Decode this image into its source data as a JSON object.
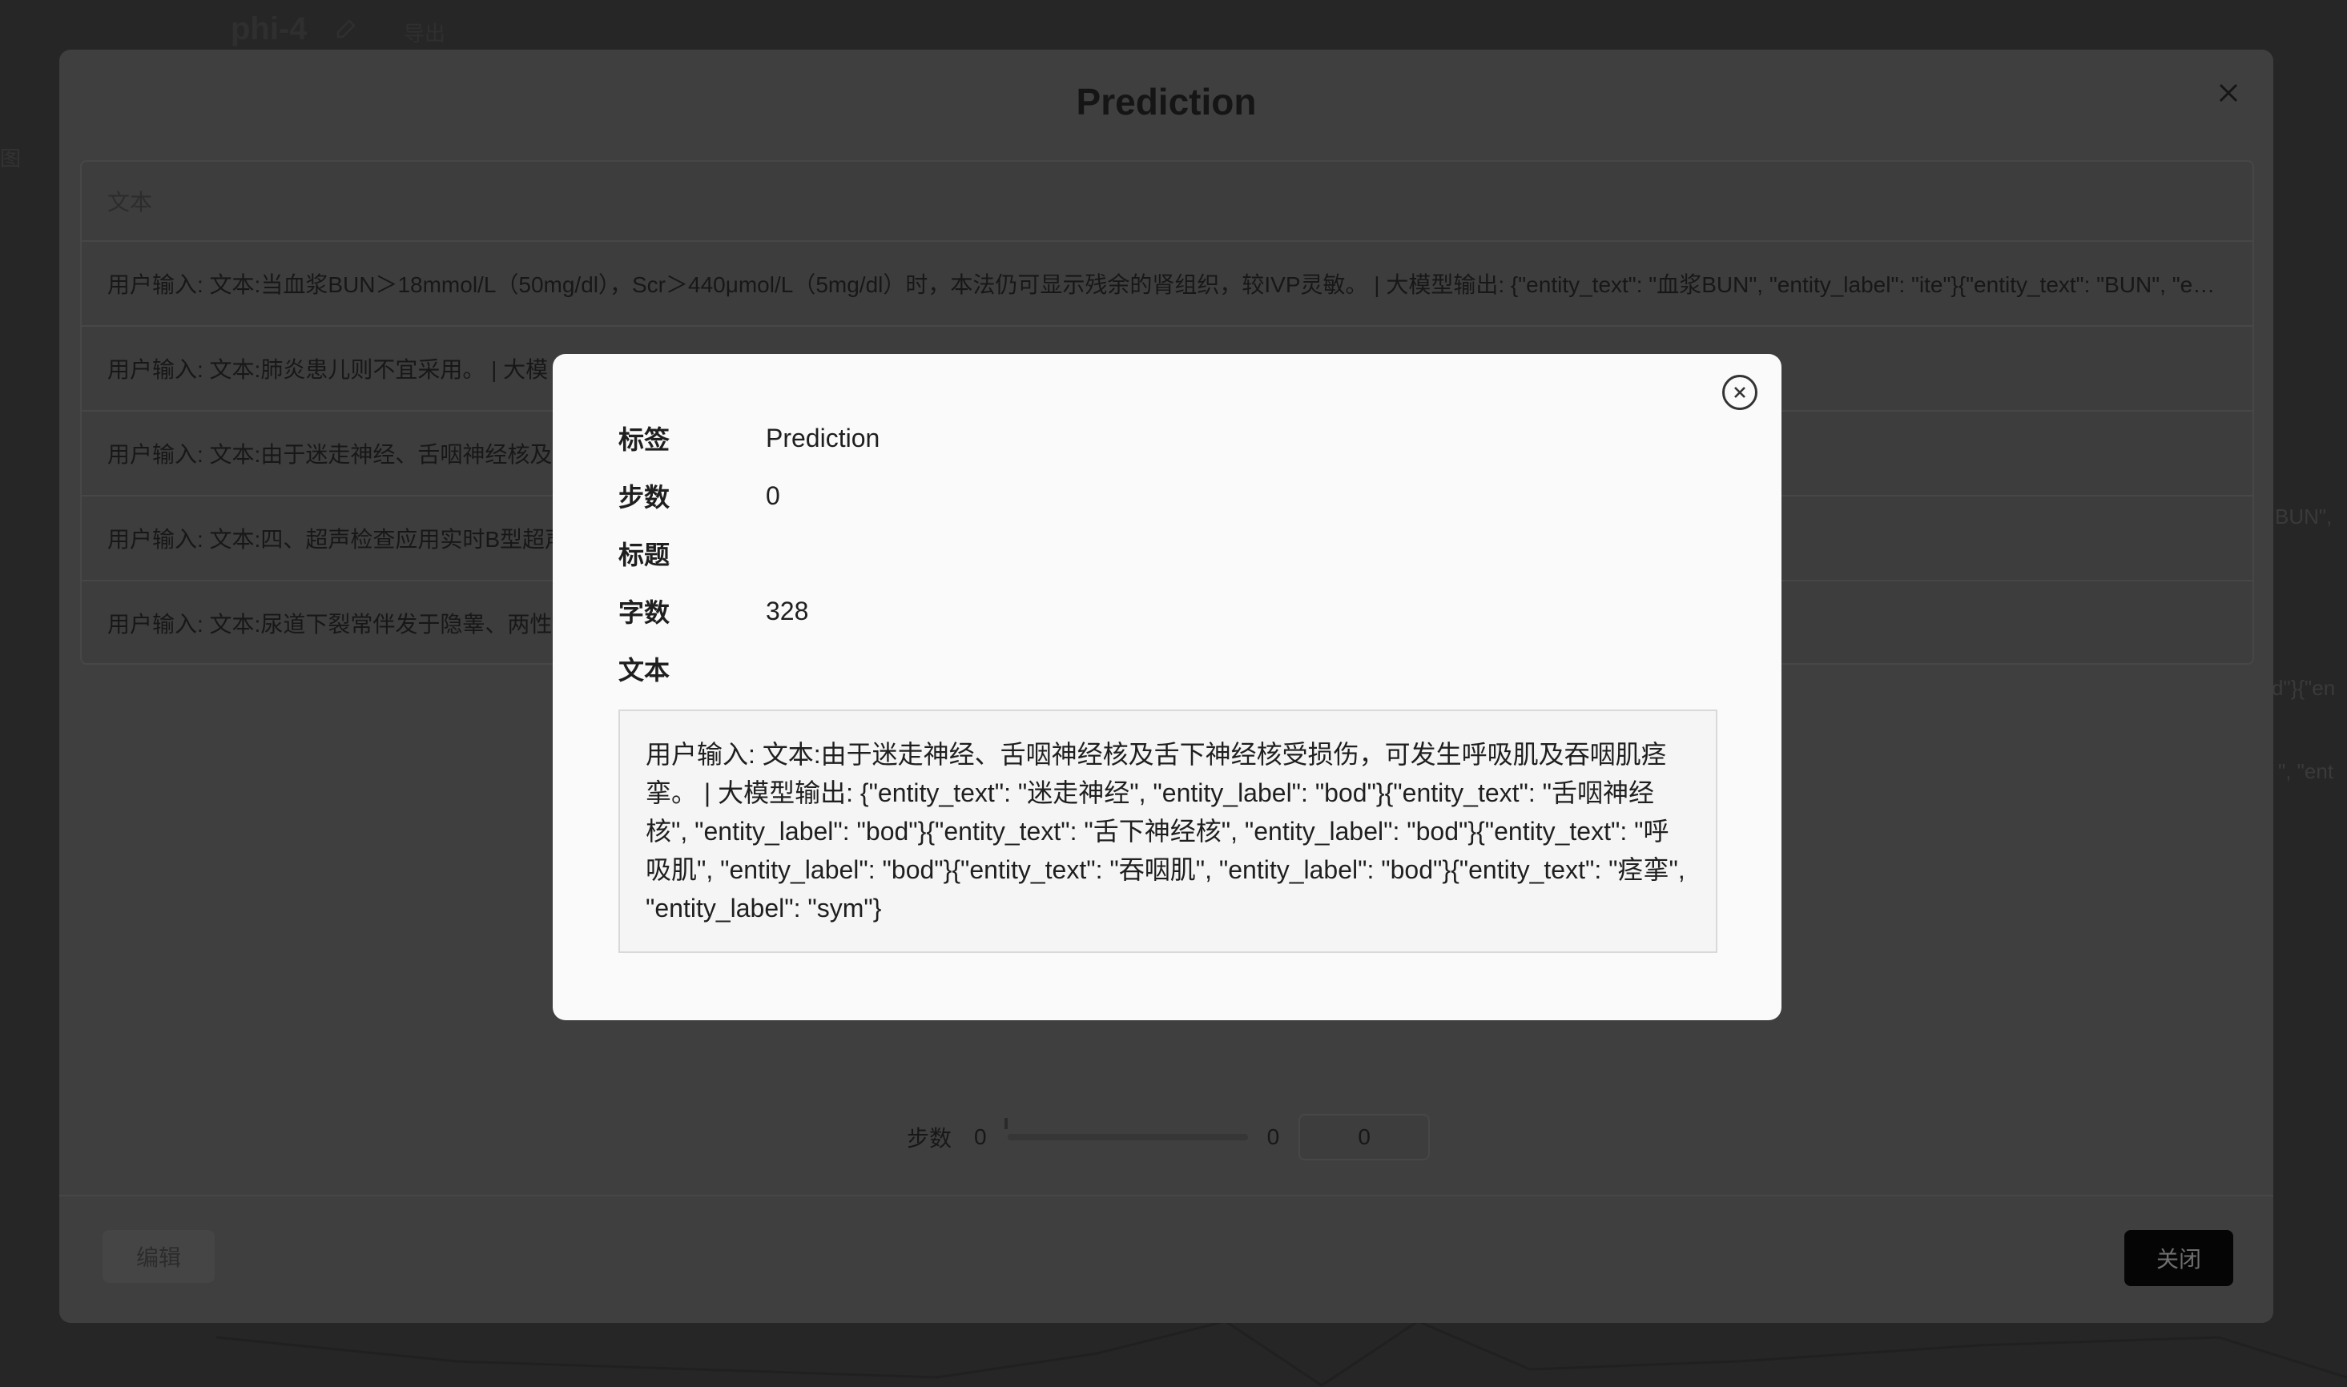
{
  "background": {
    "page_title": "phi-4",
    "link_text": "导出",
    "left_glyph": "图",
    "right_fragments": [
      "BUN\",",
      "d\"}{\"en",
      "\", \"ent"
    ]
  },
  "outer_modal": {
    "title": "Prediction",
    "table": {
      "header": "文本",
      "rows": [
        "用户输入: 文本:当血浆BUN＞18mmol/L（50mg/dl），Scr＞440μmol/L（5mg/dl）时，本法仍可显示残余的肾组织，较IVP灵敏。 | 大模型输出: {\"entity_text\": \"血浆BUN\", \"entity_label\": \"ite\"}{\"entity_text\": \"BUN\", \"entity_label\": \"ite\"}",
        "用户输入: 文本:肺炎患儿则不宜采用。 | 大模",
        "用户输入: 文本:由于迷走神经、舌咽神经核及\"舌咽神经核\", \"entity_label\": \"bod\"}{\"entity_text\": \"舌下神经核\"}",
        "用户输入: 文本:四、超声检查应用实时B型超声ite\"}{\"entity_text\": \"三维实时超声\", \"entity_label\": \"equ\"}",
        "用户输入: 文本:尿道下裂常伴发于隐睾、两性ty_text\": \"两性畸形\", \"entity_label\": \"dis\"}"
      ]
    },
    "step_label": "步数",
    "slider_min": "0",
    "slider_max": "0",
    "step_value": "0",
    "edit_button": "编辑",
    "close_button": "关闭"
  },
  "dialog": {
    "fields": {
      "label_key": "标签",
      "label_value": "Prediction",
      "step_key": "步数",
      "step_value": "0",
      "title_key": "标题",
      "title_value": "",
      "count_key": "字数",
      "count_value": "328",
      "text_key": "文本"
    },
    "text_content": "用户输入: 文本:由于迷走神经、舌咽神经核及舌下神经核受损伤，可发生呼吸肌及吞咽肌痉挛。 | 大模型输出: {\"entity_text\": \"迷走神经\", \"entity_label\": \"bod\"}{\"entity_text\": \"舌咽神经核\", \"entity_label\": \"bod\"}{\"entity_text\": \"舌下神经核\", \"entity_label\": \"bod\"}{\"entity_text\": \"呼吸肌\", \"entity_label\": \"bod\"}{\"entity_text\": \"吞咽肌\", \"entity_label\": \"bod\"}{\"entity_text\": \"痉挛\", \"entity_label\": \"sym\"}"
  },
  "icons": [
    "edit-icon",
    "close-icon",
    "circle-close-icon"
  ]
}
